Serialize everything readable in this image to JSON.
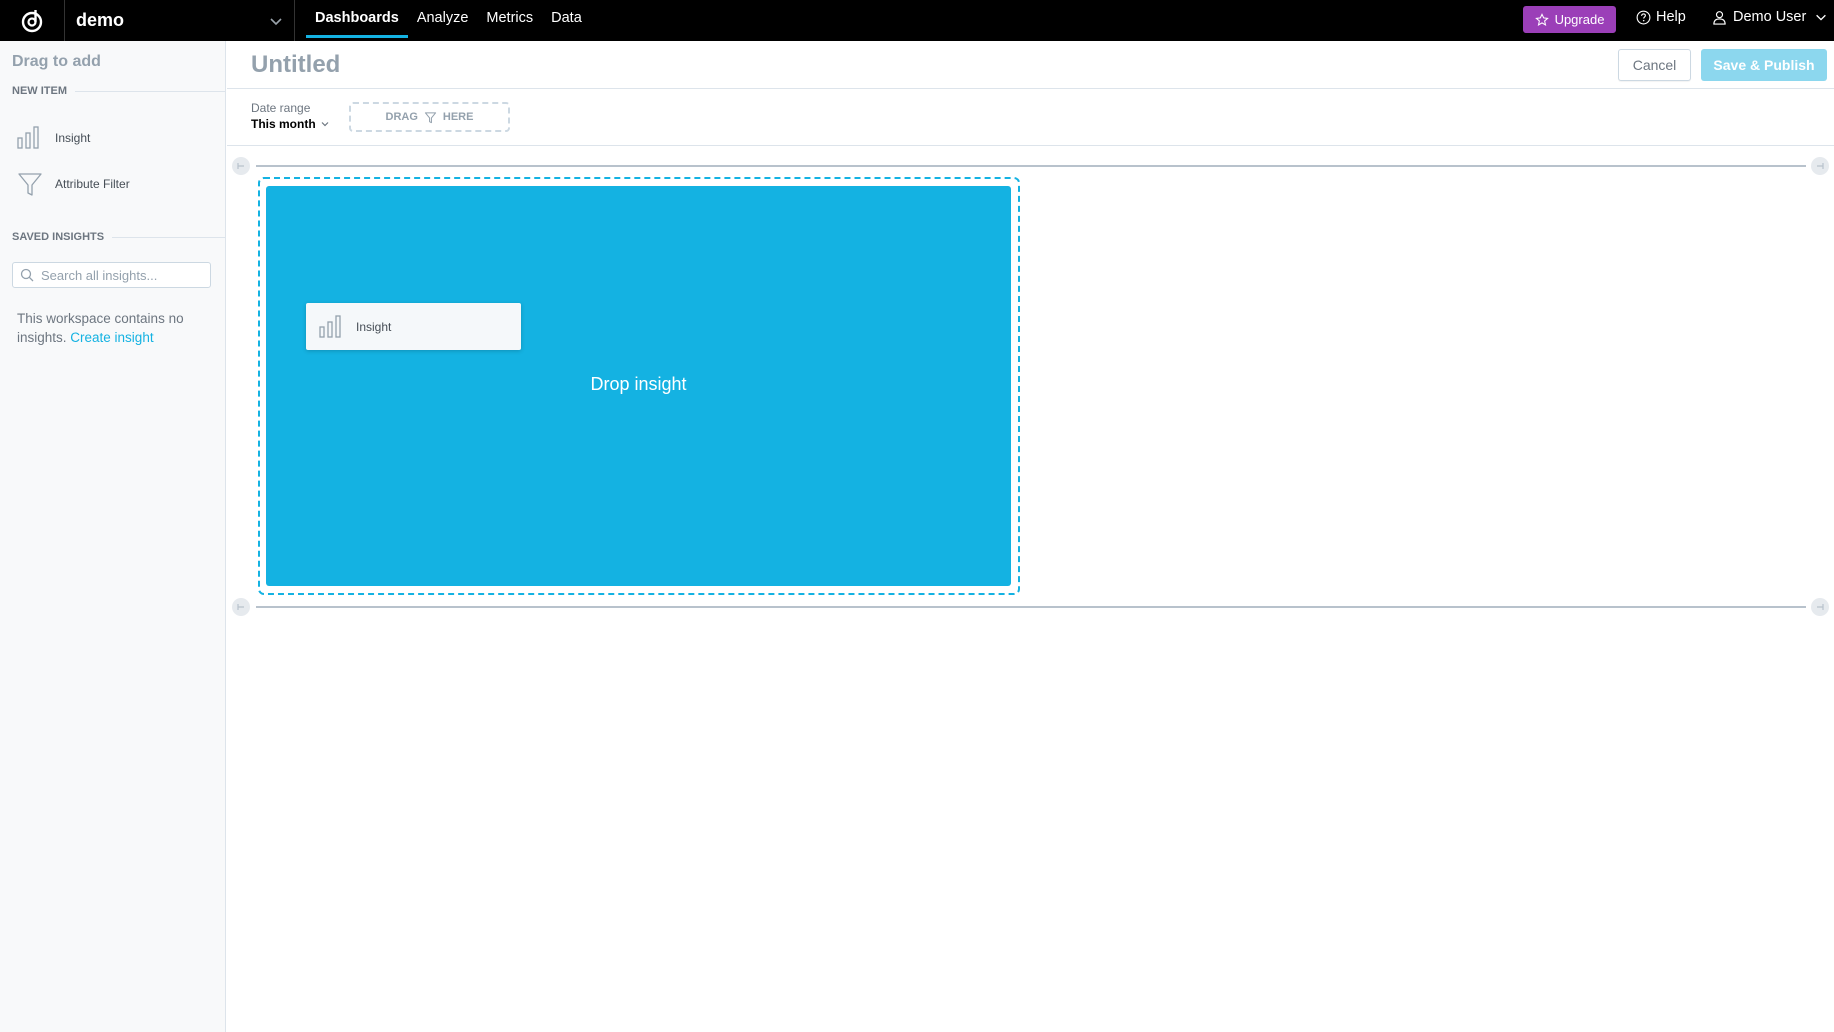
{
  "topbar": {
    "workspace": "demo",
    "nav": [
      {
        "label": "Dashboards",
        "active": true
      },
      {
        "label": "Analyze",
        "active": false
      },
      {
        "label": "Metrics",
        "active": false
      },
      {
        "label": "Data",
        "active": false
      }
    ],
    "upgrade_label": "Upgrade",
    "help_label": "Help",
    "user_label": "Demo User"
  },
  "sidebar": {
    "title": "Drag to add",
    "new_item_heading": "NEW ITEM",
    "items": [
      {
        "label": "Insight",
        "icon": "bar-chart-icon"
      },
      {
        "label": "Attribute Filter",
        "icon": "funnel-icon"
      }
    ],
    "saved_heading": "SAVED INSIGHTS",
    "search_placeholder": "Search all insights...",
    "empty_text": "This workspace contains no insights. ",
    "create_link": "Create insight"
  },
  "header": {
    "title": "Untitled",
    "cancel_label": "Cancel",
    "publish_label": "Save & Publish"
  },
  "filters": {
    "date_label": "Date range",
    "date_value": "This month",
    "drag_left": "DRAG",
    "drag_right": "HERE"
  },
  "canvas": {
    "drop_text": "Drop insight",
    "drag_card_label": "Insight"
  },
  "colors": {
    "accent": "#14b2e2",
    "upgrade": "#9b3fb8",
    "publish_disabled": "#8cd7ee"
  }
}
